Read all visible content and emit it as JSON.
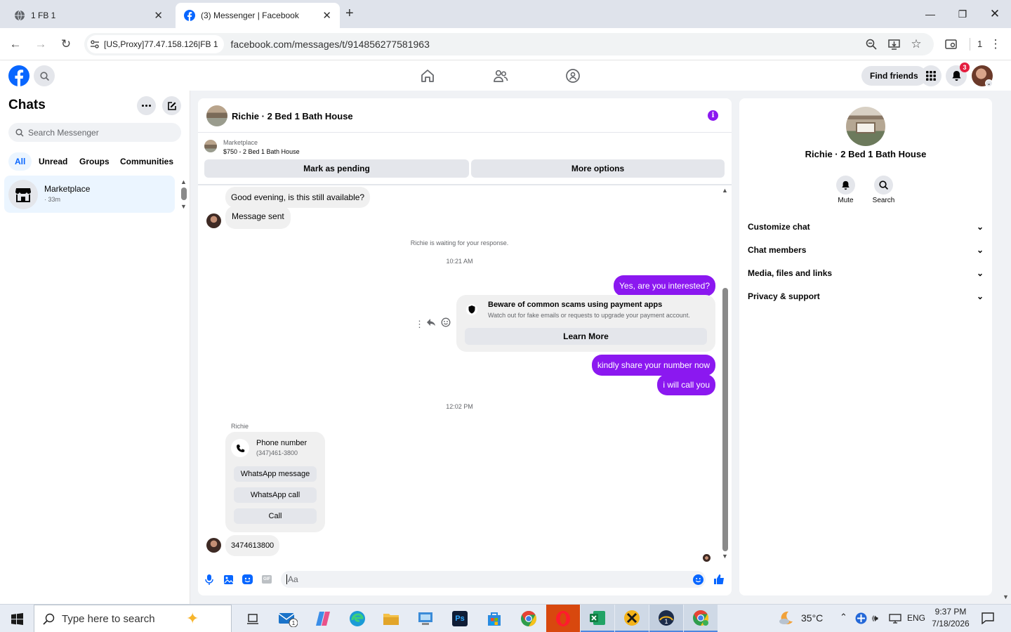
{
  "browser": {
    "tabs": [
      {
        "title": "1 FB 1"
      },
      {
        "title": "(3) Messenger | Facebook"
      }
    ],
    "proxy_label": "[US,Proxy]77.47.158.126|FB 1",
    "url": "facebook.com/messages/t/914856277581963",
    "profile_count": "1"
  },
  "fb_header": {
    "find_friends": "Find friends",
    "notif_badge": "3"
  },
  "sidebar": {
    "title": "Chats",
    "search_placeholder": "Search Messenger",
    "filters": [
      "All",
      "Unread",
      "Groups",
      "Communities"
    ],
    "chat": {
      "name": "Marketplace",
      "time": "· 33m"
    }
  },
  "conversation": {
    "title": "Richie · 2 Bed 1 Bath House",
    "listing_source": "Marketplace",
    "listing_title": "$750 - 2 Bed 1 Bath House",
    "mark_pending": "Mark as pending",
    "more_options": "More options",
    "messages": {
      "m1": "Good evening, is this still available?",
      "m2": "Message sent",
      "waiting": "Richie is waiting for your response.",
      "time1": "10:21 AM",
      "m3": "Yes, are you interested?",
      "scam_title": "Beware of common scams using payment apps",
      "scam_body": "Watch out for fake emails or requests to upgrade your payment account.",
      "learn_more": "Learn More",
      "m4": "kindly share your number now",
      "m5": "i will call you",
      "time2": "12:02 PM",
      "sender": "Richie",
      "phone_title": "Phone number",
      "phone_value": "(347)461-3800",
      "wa_message": "WhatsApp message",
      "wa_call": "WhatsApp call",
      "call": "Call",
      "m6": "3474613800"
    },
    "composer_placeholder": "Aa"
  },
  "info_panel": {
    "name": "Richie · 2 Bed 1 Bath House",
    "mute": "Mute",
    "search": "Search",
    "sections": [
      "Customize chat",
      "Chat members",
      "Media, files and links",
      "Privacy & support"
    ]
  },
  "taskbar": {
    "search_placeholder": "Type here to search",
    "weather": "35°C",
    "lang": "ENG",
    "time": "9:37 PM",
    "date": "7/18/2026"
  },
  "colors": {
    "accent": "#8b18f0",
    "fb_blue": "#0866ff",
    "badge": "#e41e3f"
  }
}
